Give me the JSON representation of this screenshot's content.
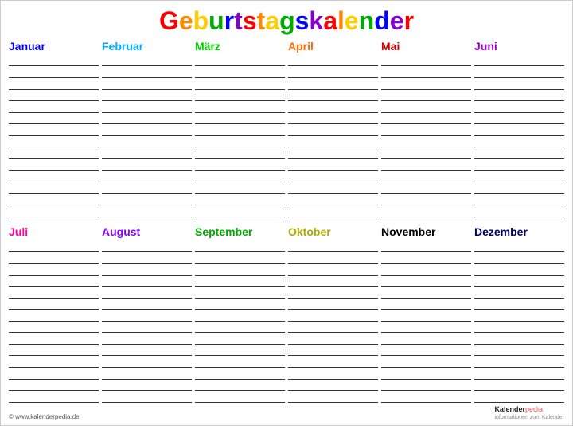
{
  "title": {
    "G": "G",
    "e": "e",
    "b": "b",
    "u": "u",
    "r": "r",
    "t": "t",
    "s": "s",
    "t2": "t",
    "a": "a",
    "g": "g",
    "s2": "s",
    "k": "k",
    "a2": "a",
    "l": "l",
    "e2": "e",
    "n": "n",
    "d": "d",
    "e3": "e",
    "full": "Geburtstagskalender"
  },
  "top_months": [
    {
      "name": "Januar",
      "color": "#0000ff"
    },
    {
      "name": "Februar",
      "color": "#00aaff"
    },
    {
      "name": "März",
      "color": "#00cc00"
    },
    {
      "name": "April",
      "color": "#ff6600"
    },
    {
      "name": "Mai",
      "color": "#cc0000"
    },
    {
      "name": "Juni",
      "color": "#9900cc"
    }
  ],
  "bottom_months": [
    {
      "name": "Juli",
      "color": "#ff00aa"
    },
    {
      "name": "August",
      "color": "#8800ff"
    },
    {
      "name": "September",
      "color": "#00aa00"
    },
    {
      "name": "Oktober",
      "color": "#aaaa00"
    },
    {
      "name": "November",
      "color": "#000000"
    },
    {
      "name": "Dezember",
      "color": "#000066"
    }
  ],
  "lines_count": 14,
  "footer": {
    "copyright": "© www.kalenderpedia.de",
    "logo_kalender": "Kalender",
    "logo_pedia": "pedia",
    "logo_sub": "informationen zum Kalender"
  },
  "title_letters": [
    {
      "char": "G",
      "color": "#ff0000"
    },
    {
      "char": "e",
      "color": "#ff8800"
    },
    {
      "char": "b",
      "color": "#ffcc00"
    },
    {
      "char": "u",
      "color": "#00aa00"
    },
    {
      "char": "r",
      "color": "#0000ff"
    },
    {
      "char": "t",
      "color": "#8800cc"
    },
    {
      "char": "s",
      "color": "#ff0000"
    },
    {
      "char": "t",
      "color": "#ff8800"
    },
    {
      "char": "a",
      "color": "#ffcc00"
    },
    {
      "char": "g",
      "color": "#00aa00"
    },
    {
      "char": "s",
      "color": "#0000ff"
    },
    {
      "char": "k",
      "color": "#8800cc"
    },
    {
      "char": "a",
      "color": "#ff0000"
    },
    {
      "char": "l",
      "color": "#ff8800"
    },
    {
      "char": "e",
      "color": "#ffcc00"
    },
    {
      "char": "n",
      "color": "#00aa00"
    },
    {
      "char": "d",
      "color": "#0000ff"
    },
    {
      "char": "e",
      "color": "#8800cc"
    },
    {
      "char": "r",
      "color": "#ff0000"
    }
  ]
}
